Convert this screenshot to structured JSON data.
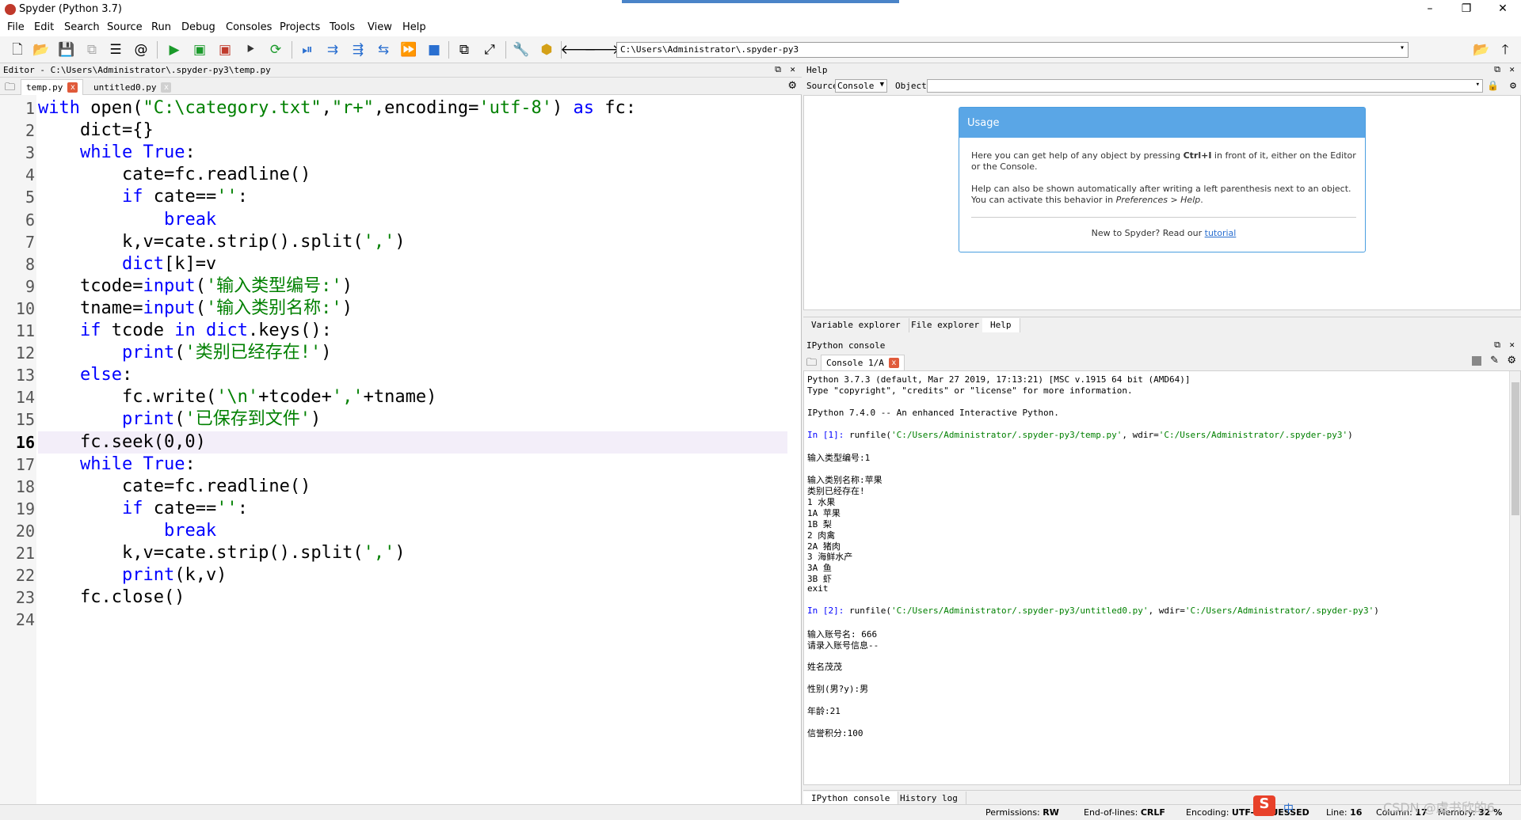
{
  "window": {
    "title": "Spyder (Python 3.7)",
    "controls": {
      "minimize": "–",
      "restore": "❐",
      "close": "✕"
    }
  },
  "menu": [
    "File",
    "Edit",
    "Search",
    "Source",
    "Run",
    "Debug",
    "Consoles",
    "Projects",
    "Tools",
    "View",
    "Help"
  ],
  "toolbar": {
    "icons": [
      "new-file-icon",
      "open-file-icon",
      "save-icon",
      "save-all-icon",
      "outline-icon",
      "at-icon",
      "run-icon",
      "run-cell-icon",
      "run-cell-advance-icon",
      "run-selection-icon",
      "rerun-icon",
      "debug-icon",
      "step-icon",
      "step-into-icon",
      "step-return-icon",
      "continue-icon",
      "stop-icon",
      "maximize-pane-icon",
      "fullscreen-icon",
      "preferences-icon",
      "python-path-icon",
      "back-arrow-icon",
      "forward-arrow-icon",
      "browse-folder-icon",
      "parent-dir-icon"
    ],
    "working_directory": "C:\\Users\\Administrator\\.spyder-py3"
  },
  "editor": {
    "title": "Editor - C:\\Users\\Administrator\\.spyder-py3\\temp.py",
    "tabs": [
      {
        "label": "temp.py",
        "close": "x"
      },
      {
        "label": "untitled0.py",
        "close": "x"
      }
    ],
    "current_line": 16,
    "line_numbers": [
      "1",
      "2",
      "3",
      "4",
      "5",
      "6",
      "7",
      "8",
      "9",
      "10",
      "11",
      "12",
      "13",
      "14",
      "15",
      "16",
      "17",
      "18",
      "19",
      "20",
      "21",
      "22",
      "23",
      "24"
    ],
    "lines": [
      [
        [
          "kw",
          "with "
        ],
        [
          "",
          "open("
        ],
        [
          "st",
          "\"C:\\category.txt\""
        ],
        [
          "",
          ","
        ],
        [
          "st",
          "\"r+\""
        ],
        [
          "",
          ",encoding="
        ],
        [
          "st",
          "'utf-8'"
        ],
        [
          "",
          ") "
        ],
        [
          "kw",
          "as"
        ],
        [
          "",
          " fc:"
        ]
      ],
      [
        [
          "",
          "    dict={}"
        ]
      ],
      [
        [
          "",
          "    "
        ],
        [
          "kw",
          "while"
        ],
        [
          "",
          " "
        ],
        [
          "kw",
          "True"
        ],
        [
          "",
          ":"
        ]
      ],
      [
        [
          "",
          "        cate=fc.readline()"
        ]
      ],
      [
        [
          "",
          "        "
        ],
        [
          "kw",
          "if"
        ],
        [
          "",
          " cate=="
        ],
        [
          "st",
          "''"
        ],
        [
          "",
          ":"
        ]
      ],
      [
        [
          "",
          "            "
        ],
        [
          "kw",
          "break"
        ]
      ],
      [
        [
          "",
          "        k,v=cate.strip().split("
        ],
        [
          "st",
          "','"
        ],
        [
          "",
          ")"
        ]
      ],
      [
        [
          "",
          "        "
        ],
        [
          "kw",
          "dict"
        ],
        [
          "",
          "[k]=v"
        ]
      ],
      [
        [
          "",
          "    tcode="
        ],
        [
          "kw",
          "input"
        ],
        [
          "",
          "("
        ],
        [
          "st",
          "'输入类型编号:'"
        ],
        [
          "",
          ")"
        ]
      ],
      [
        [
          "",
          "    tname="
        ],
        [
          "kw",
          "input"
        ],
        [
          "",
          "("
        ],
        [
          "st",
          "'输入类别名称:'"
        ],
        [
          "",
          ")"
        ]
      ],
      [
        [
          "",
          "    "
        ],
        [
          "kw",
          "if"
        ],
        [
          "",
          " tcode "
        ],
        [
          "kw",
          "in"
        ],
        [
          "",
          " "
        ],
        [
          "kw",
          "dict"
        ],
        [
          "",
          ".keys():"
        ]
      ],
      [
        [
          "",
          "        "
        ],
        [
          "kw",
          "print"
        ],
        [
          "",
          "("
        ],
        [
          "st",
          "'类别已经存在!'"
        ],
        [
          "",
          ")"
        ]
      ],
      [
        [
          "",
          "    "
        ],
        [
          "kw",
          "else"
        ],
        [
          "",
          ":"
        ]
      ],
      [
        [
          "",
          "        fc.write("
        ],
        [
          "st",
          "'\\n'"
        ],
        [
          "",
          "+tcode+"
        ],
        [
          "st",
          "','"
        ],
        [
          "",
          "+tname)"
        ]
      ],
      [
        [
          "",
          "        "
        ],
        [
          "kw",
          "print"
        ],
        [
          "",
          "("
        ],
        [
          "st",
          "'已保存到文件'"
        ],
        [
          "",
          ")"
        ]
      ],
      [
        [
          "",
          "    fc.seek(0,0)"
        ]
      ],
      [
        [
          "",
          "    "
        ],
        [
          "kw",
          "while"
        ],
        [
          "",
          " "
        ],
        [
          "kw",
          "True"
        ],
        [
          "",
          ":"
        ]
      ],
      [
        [
          "",
          "        cate=fc.readline()"
        ]
      ],
      [
        [
          "",
          "        "
        ],
        [
          "kw",
          "if"
        ],
        [
          "",
          " cate=="
        ],
        [
          "st",
          "''"
        ],
        [
          "",
          ":"
        ]
      ],
      [
        [
          "",
          "            "
        ],
        [
          "kw",
          "break"
        ]
      ],
      [
        [
          "",
          "        k,v=cate.strip().split("
        ],
        [
          "st",
          "','"
        ],
        [
          "",
          ")"
        ]
      ],
      [
        [
          "",
          "        "
        ],
        [
          "kw",
          "print"
        ],
        [
          "",
          "(k,v)"
        ]
      ],
      [
        [
          "",
          "    fc.close()"
        ]
      ],
      [
        [
          "",
          ""
        ]
      ]
    ]
  },
  "help": {
    "title": "Help",
    "source_label": "Source",
    "source_value": "Console",
    "object_label": "Object",
    "usage": {
      "heading": "Usage",
      "p1_pre": "Here you can get help of any object by pressing ",
      "p1_key": "Ctrl+I",
      "p1_post": " in front of it, either on the Editor or the Console.",
      "p2_pre": "Help can also be shown automatically after writing a left parenthesis next to an object. You can activate this behavior in ",
      "p2_em": "Preferences > Help",
      "p2_post": ".",
      "footer_pre": "New to Spyder? Read our ",
      "footer_link": "tutorial"
    },
    "tabs": [
      "Variable explorer",
      "File explorer",
      "Help"
    ]
  },
  "console": {
    "title": "IPython console",
    "tab": "Console 1/A",
    "lines": [
      [
        [
          "",
          "Python 3.7.3 (default, Mar 27 2019, 17:13:21) [MSC v.1915 64 bit (AMD64)]"
        ]
      ],
      [
        [
          "",
          "Type \"copyright\", \"credits\" or \"license\" for more information."
        ]
      ],
      [
        [
          "",
          ""
        ]
      ],
      [
        [
          "",
          "IPython 7.4.0 -- An enhanced Interactive Python."
        ]
      ],
      [
        [
          "",
          ""
        ]
      ],
      [
        [
          "cin",
          "In [1]: "
        ],
        [
          "",
          "runfile("
        ],
        [
          "cst",
          "'C:/Users/Administrator/.spyder-py3/temp.py'"
        ],
        [
          "",
          ", wdir="
        ],
        [
          "cst",
          "'C:/Users/Administrator/.spyder-py3'"
        ],
        [
          "",
          ")"
        ]
      ],
      [
        [
          "",
          ""
        ]
      ],
      [
        [
          "",
          "输入类型编号:1"
        ]
      ],
      [
        [
          "",
          ""
        ]
      ],
      [
        [
          "",
          "输入类别名称:苹果"
        ]
      ],
      [
        [
          "",
          "类别已经存在!"
        ]
      ],
      [
        [
          "",
          "1 水果"
        ]
      ],
      [
        [
          "",
          "1A 苹果"
        ]
      ],
      [
        [
          "",
          "1B 梨"
        ]
      ],
      [
        [
          "",
          "2 肉禽"
        ]
      ],
      [
        [
          "",
          "2A 猪肉"
        ]
      ],
      [
        [
          "",
          "3 海鲜水产"
        ]
      ],
      [
        [
          "",
          "3A 鱼"
        ]
      ],
      [
        [
          "",
          "3B 虾"
        ]
      ],
      [
        [
          "",
          "exit"
        ]
      ],
      [
        [
          "",
          ""
        ]
      ],
      [
        [
          "cin",
          "In [2]: "
        ],
        [
          "",
          "runfile("
        ],
        [
          "cst",
          "'C:/Users/Administrator/.spyder-py3/untitled0.py'"
        ],
        [
          "",
          ", wdir="
        ],
        [
          "cst",
          "'C:/Users/Administrator/.spyder-py3'"
        ],
        [
          "",
          ")"
        ]
      ],
      [
        [
          "",
          ""
        ]
      ],
      [
        [
          "",
          "输入账号名: 666"
        ]
      ],
      [
        [
          "",
          "请录入账号信息--"
        ]
      ],
      [
        [
          "",
          ""
        ]
      ],
      [
        [
          "",
          "姓名茂茂"
        ]
      ],
      [
        [
          "",
          ""
        ]
      ],
      [
        [
          "",
          "性别(男?y):男"
        ]
      ],
      [
        [
          "",
          ""
        ]
      ],
      [
        [
          "",
          "年龄:21"
        ]
      ],
      [
        [
          "",
          ""
        ]
      ],
      [
        [
          "",
          "信誉积分:100"
        ]
      ]
    ],
    "bottom_tabs": [
      "IPython console",
      "History log"
    ]
  },
  "status": {
    "permissions_label": "Permissions:",
    "permissions_value": "RW",
    "eol_label": "End-of-lines:",
    "eol_value": "CRLF",
    "encoding_label": "Encoding:",
    "encoding_value": "UTF-8-GUESSED",
    "line_label": "Line:",
    "line_value": "16",
    "column_label": "Column:",
    "column_value": "17",
    "memory_label": "Memory:",
    "memory_value": "32 %",
    "watermark": "CSDN @虞书欣的6",
    "ime": "中"
  },
  "colors": {
    "keyword": "#0000ff",
    "string": "#008000",
    "usage_header": "#5aa6e6",
    "current_line": "#f3eef9"
  }
}
